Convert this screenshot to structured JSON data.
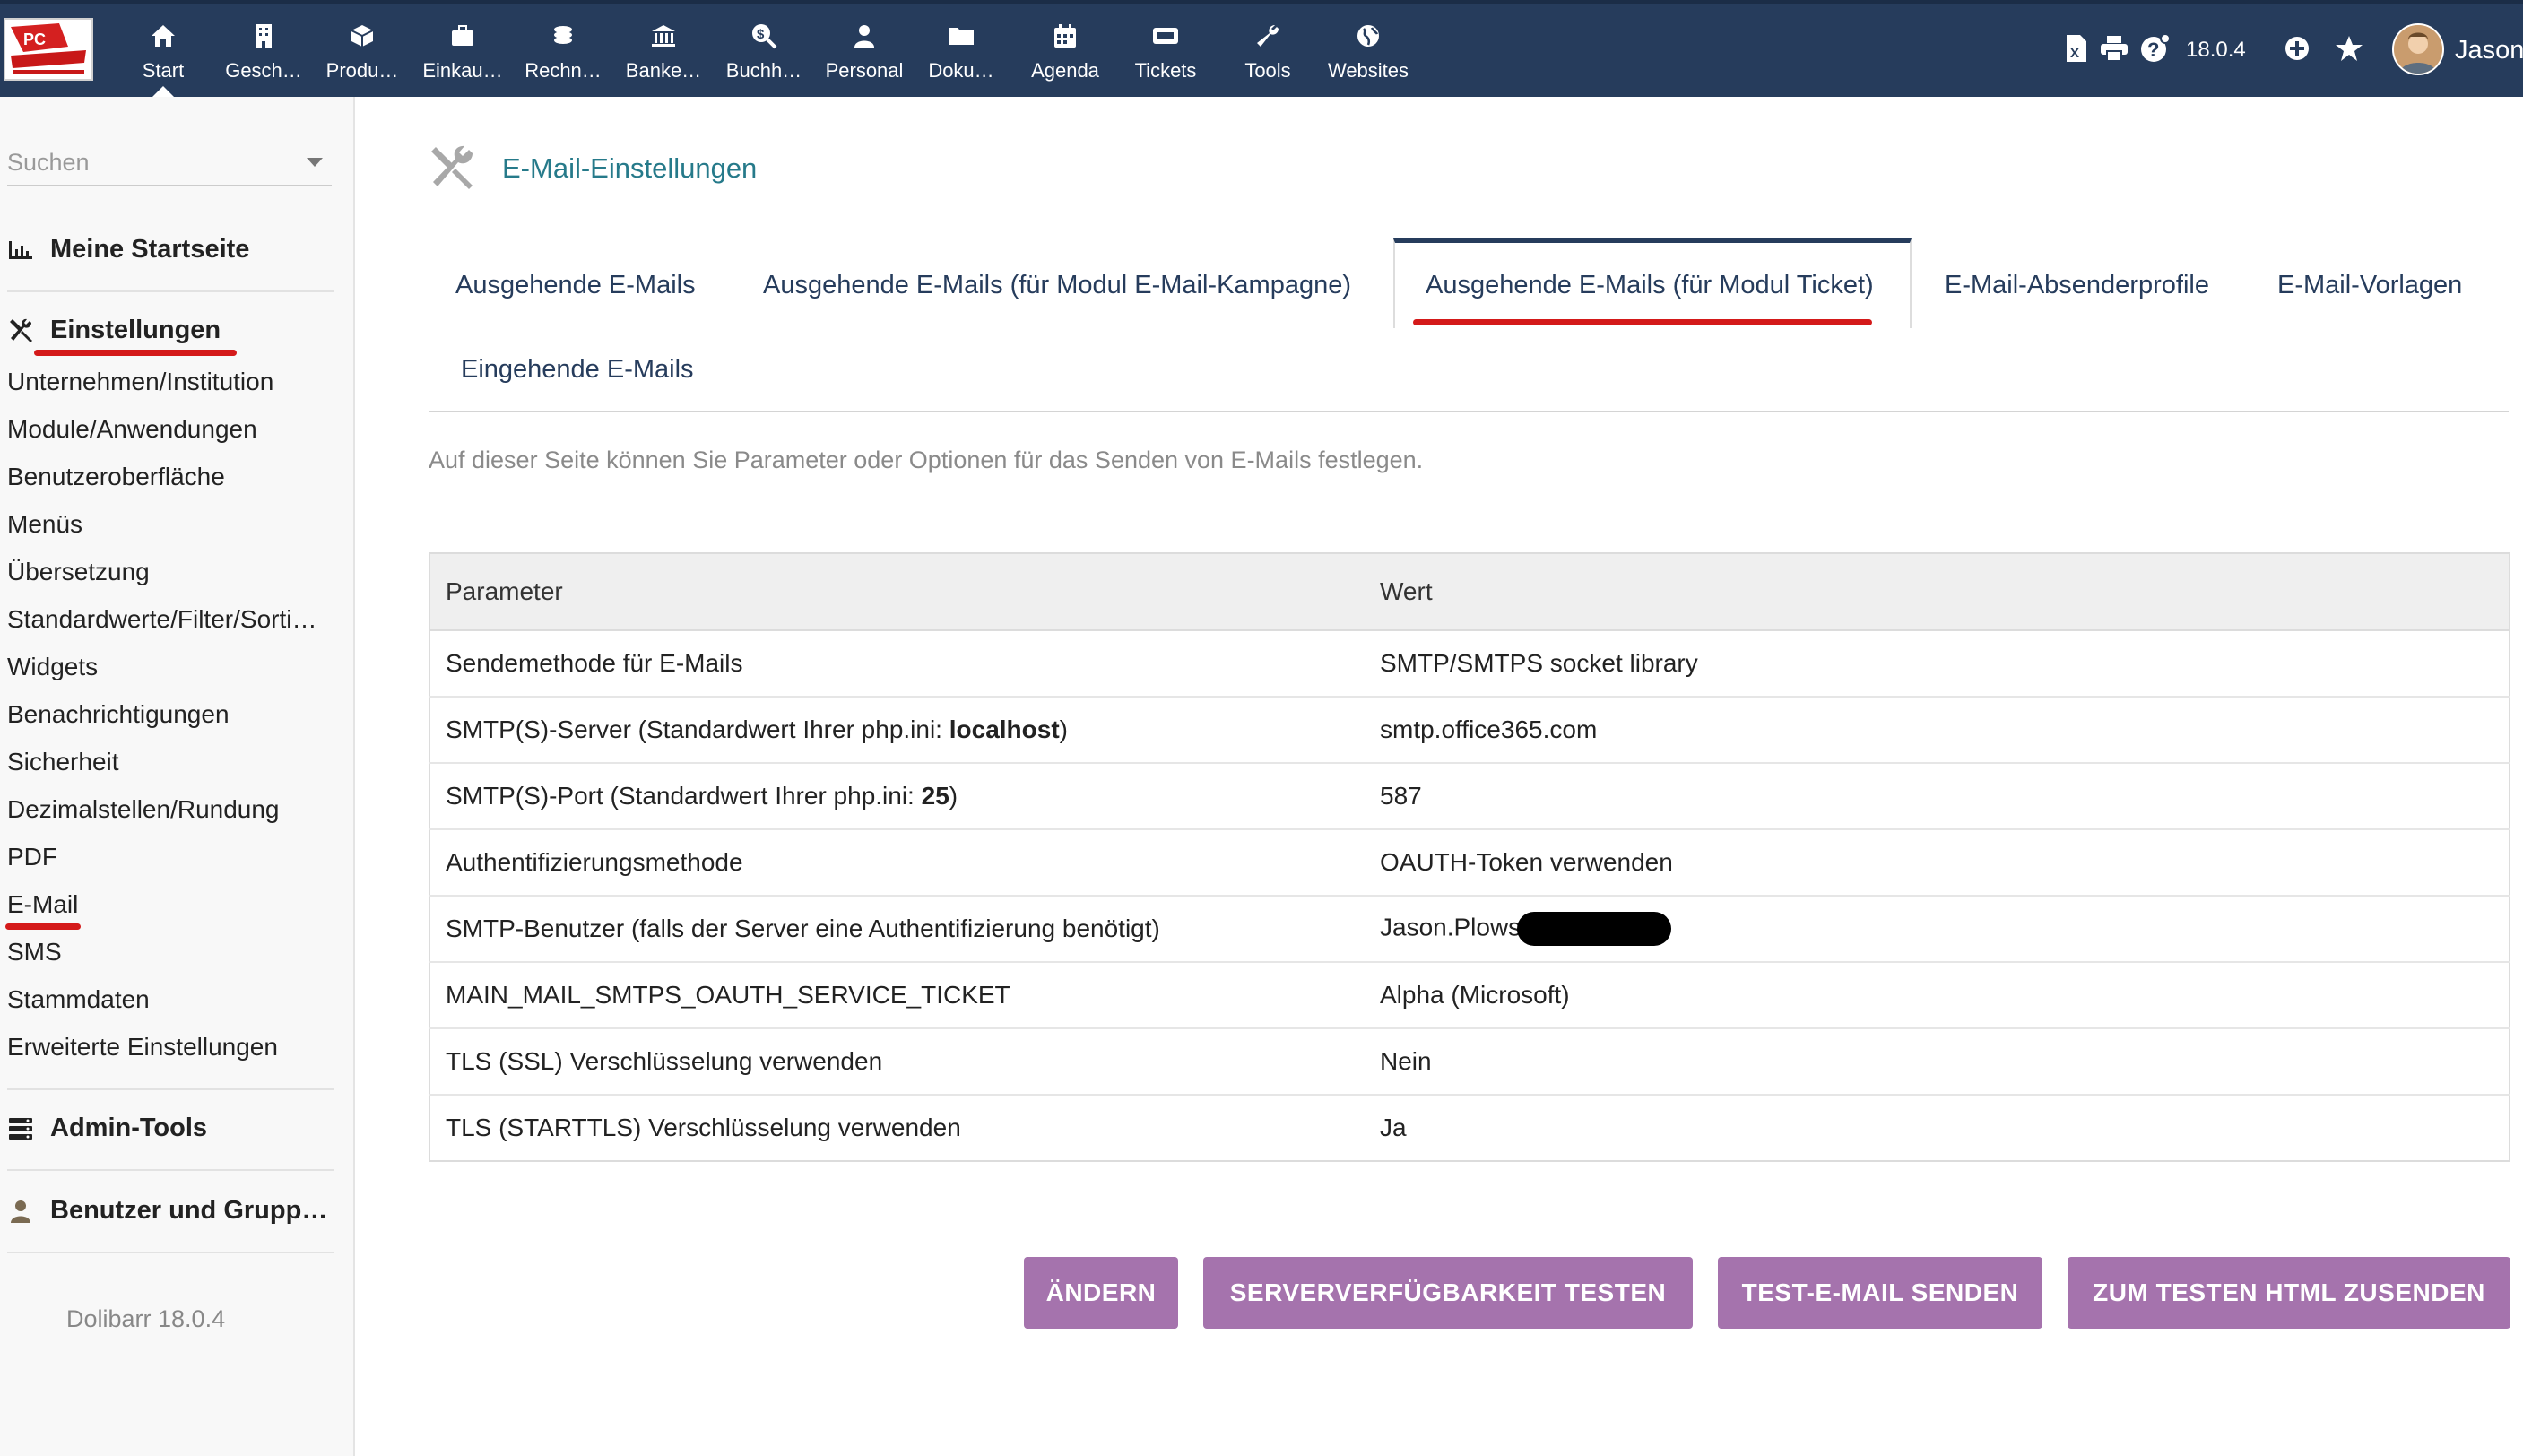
{
  "topbar": {
    "nav": [
      {
        "label": "Start",
        "icon": "home-icon",
        "active": true
      },
      {
        "label": "Gesch…",
        "icon": "building-icon"
      },
      {
        "label": "Produ…",
        "icon": "cube-icon"
      },
      {
        "label": "Einkau…",
        "icon": "briefcase-icon"
      },
      {
        "label": "Rechn…",
        "icon": "coins-icon"
      },
      {
        "label": "Banke…",
        "icon": "bank-icon"
      },
      {
        "label": "Buchh…",
        "icon": "search-dollar-icon"
      },
      {
        "label": "Personal",
        "icon": "person-icon"
      },
      {
        "label": "Doku…",
        "icon": "folder-icon"
      },
      {
        "label": "Agenda",
        "icon": "calendar-icon"
      },
      {
        "label": "Tickets",
        "icon": "ticket-icon"
      },
      {
        "label": "Tools",
        "icon": "wrench-icon"
      },
      {
        "label": "Websites",
        "icon": "globe-icon"
      }
    ],
    "version": "18.0.4",
    "username": "Jason",
    "accent": "#263c5c"
  },
  "sidebar": {
    "search_placeholder": "Suchen",
    "home_label": "Meine Startseite",
    "settings_label": "Einstellungen",
    "settings_items": [
      "Unternehmen/Institution",
      "Module/Anwendungen",
      "Benutzeroberfläche",
      "Menüs",
      "Übersetzung",
      "Standardwerte/Filter/Sorti…",
      "Widgets",
      "Benachrichtigungen",
      "Sicherheit",
      "Dezimalstellen/Rundung",
      "PDF",
      "E-Mail",
      "SMS",
      "Stammdaten",
      "Erweiterte Einstellungen"
    ],
    "admin_tools_label": "Admin-Tools",
    "users_groups_label": "Benutzer und Grupp…",
    "footer": "Dolibarr 18.0.4"
  },
  "main": {
    "title": "E-Mail-Einstellungen",
    "tabs": [
      "Ausgehende E-Mails",
      "Ausgehende E-Mails (für Modul E-Mail-Kampagne)",
      "Ausgehende E-Mails (für Modul Ticket)",
      "E-Mail-Absenderprofile",
      "E-Mail-Vorlagen",
      "Eingehende E-Mails"
    ],
    "active_tab": "Ausgehende E-Mails (für Modul Ticket)",
    "intro": "Auf dieser Seite können Sie Parameter oder Optionen für das Senden von E-Mails festlegen.",
    "table": {
      "col_param": "Parameter",
      "col_value": "Wert",
      "rows": [
        {
          "param": "Sendemethode für E-Mails",
          "value": "SMTP/SMTPS socket library"
        },
        {
          "param_pre": "SMTP(S)-Server (Standardwert Ihrer php.ini: ",
          "param_bold": "localhost",
          "param_post": ")",
          "value": "smtp.office365.com"
        },
        {
          "param_pre": "SMTP(S)-Port (Standardwert Ihrer php.ini: ",
          "param_bold": "25",
          "param_post": ")",
          "value": "587"
        },
        {
          "param": "Authentifizierungsmethode",
          "value": "OAUTH-Token verwenden"
        },
        {
          "param": "SMTP-Benutzer (falls der Server eine Authentifizierung benötigt)",
          "value": "Jason.Plows"
        },
        {
          "param": "MAIN_MAIL_SMTPS_OAUTH_SERVICE_TICKET",
          "value": "Alpha (Microsoft)"
        },
        {
          "param": "TLS (SSL) Verschlüsselung verwenden",
          "value": "Nein"
        },
        {
          "param": "TLS (STARTTLS) Verschlüsselung verwenden",
          "value": "Ja"
        }
      ]
    },
    "buttons": {
      "modify": "ÄNDERN",
      "test_server": "SERVERVERFÜGBARKEIT TESTEN",
      "send_test": "TEST-E-MAIL SENDEN",
      "send_html": "ZUM TESTEN HTML ZUSENDEN"
    },
    "button_color": "#a573ad",
    "annotation_color": "#d41a1a"
  }
}
